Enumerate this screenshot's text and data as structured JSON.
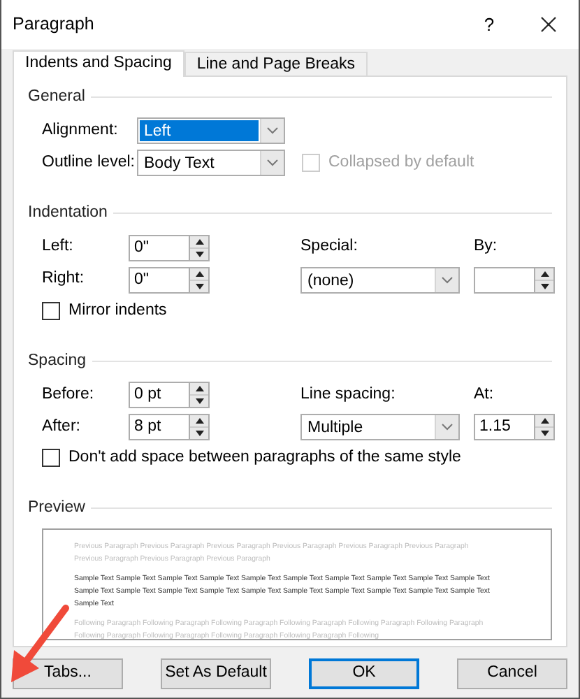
{
  "window": {
    "title": "Paragraph",
    "help": "?"
  },
  "tabs": [
    {
      "label": "Indents and Spacing",
      "selected": true
    },
    {
      "label": "Line and Page Breaks",
      "selected": false
    }
  ],
  "general": {
    "title": "General",
    "alignment": {
      "label": "Alignment:",
      "value": "Left",
      "highlighted": true
    },
    "outline_level": {
      "label": "Outline level:",
      "value": "Body Text",
      "highlighted": false
    },
    "collapsed": {
      "label": "Collapsed by default",
      "checked": false,
      "disabled": true
    }
  },
  "indentation": {
    "title": "Indentation",
    "left": {
      "label": "Left:",
      "value": "0\""
    },
    "right": {
      "label": "Right:",
      "value": "0\""
    },
    "special": {
      "label": "Special:",
      "value": "(none)",
      "highlighted": false
    },
    "by": {
      "label": "By:"
    },
    "mirror": {
      "label": "Mirror indents",
      "checked": false,
      "disabled": false
    }
  },
  "spacing": {
    "title": "Spacing",
    "before": {
      "label": "Before:",
      "value": "0 pt"
    },
    "after": {
      "label": "After:",
      "value": "8 pt"
    },
    "line_spacing": {
      "label": "Line spacing:",
      "value": "Multiple",
      "highlighted": false
    },
    "at": {
      "label": "At:",
      "value": "1.15"
    },
    "dont_add": {
      "label": "Don't add space between paragraphs of the same style",
      "checked": false,
      "disabled": false
    }
  },
  "preview": {
    "title": "Preview",
    "paragraphs": [
      {
        "kind": "context",
        "text": "Previous Paragraph Previous Paragraph Previous Paragraph Previous Paragraph Previous Paragraph Previous Paragraph Previous Paragraph Previous Paragraph Previous Paragraph"
      },
      {
        "kind": "sample",
        "text": "Sample Text Sample Text Sample Text Sample Text Sample Text Sample Text Sample Text Sample Text Sample Text Sample Text Sample Text Sample Text Sample Text Sample Text Sample Text Sample Text Sample Text Sample Text Sample Text Sample Text Sample Text"
      },
      {
        "kind": "context",
        "text": "Following Paragraph Following Paragraph Following Paragraph Following Paragraph Following Paragraph Following Paragraph Following Paragraph Following Paragraph Following Paragraph Following Paragraph Following"
      }
    ]
  },
  "buttons": [
    {
      "label": "Tabs...",
      "is_default": false
    },
    {
      "label": "Set As Default",
      "is_default": false
    },
    {
      "label": "OK",
      "is_default": true
    },
    {
      "label": "Cancel",
      "is_default": false
    }
  ]
}
